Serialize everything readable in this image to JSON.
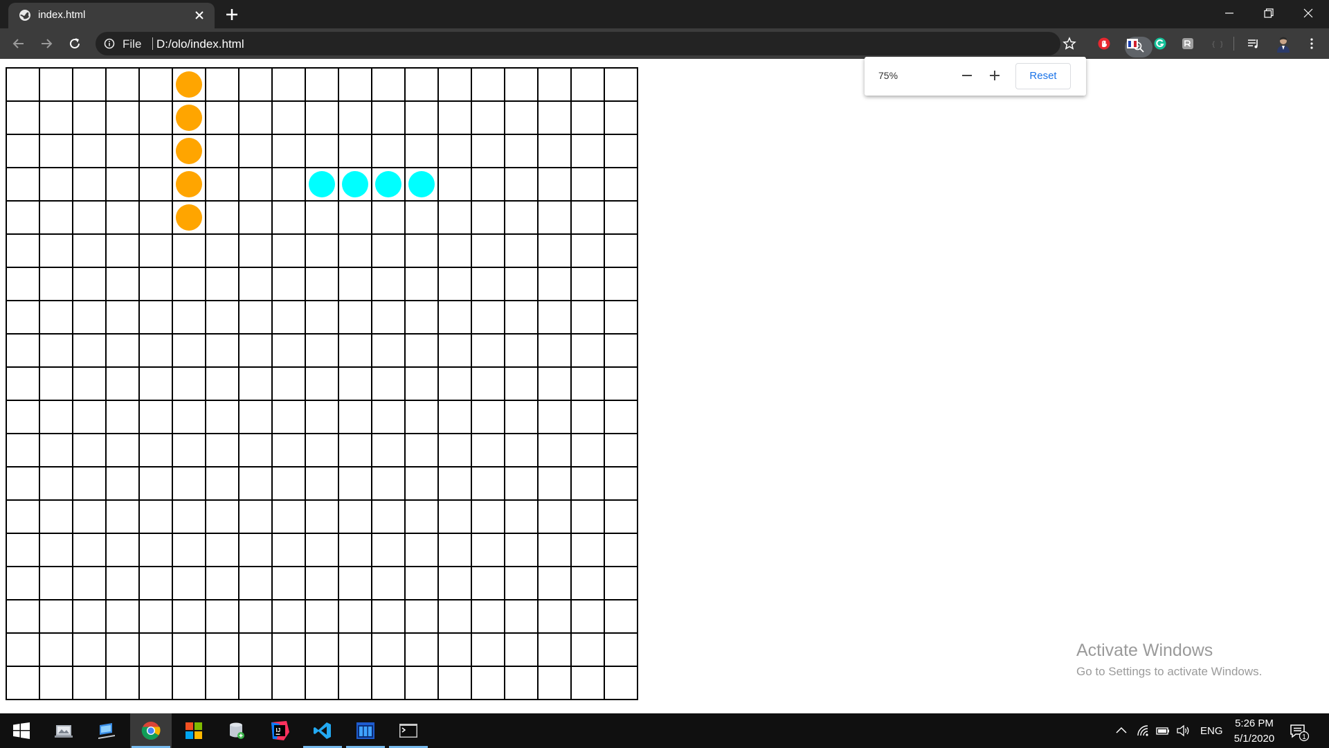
{
  "browser": {
    "tab": {
      "title": "index.html",
      "icon": "globe-icon"
    },
    "address": {
      "scheme_label": "File",
      "url": "D:/olo/index.html"
    },
    "extensions": [
      "adblock-icon",
      "flag-extension-icon",
      "grammarly-icon",
      "extension-icon",
      "extension-disabled-icon"
    ]
  },
  "zoom_popup": {
    "level": "75%",
    "reset_label": "Reset",
    "accent_color": "#1a73e8"
  },
  "board": {
    "rows": 19,
    "cols": 19,
    "line_color": "#000000",
    "stones": [
      {
        "row": 0,
        "col": 5,
        "color": "#ffa500"
      },
      {
        "row": 1,
        "col": 5,
        "color": "#ffa500"
      },
      {
        "row": 2,
        "col": 5,
        "color": "#ffa500"
      },
      {
        "row": 3,
        "col": 5,
        "color": "#ffa500"
      },
      {
        "row": 4,
        "col": 5,
        "color": "#ffa500"
      },
      {
        "row": 3,
        "col": 9,
        "color": "#00ffff"
      },
      {
        "row": 3,
        "col": 10,
        "color": "#00ffff"
      },
      {
        "row": 3,
        "col": 11,
        "color": "#00ffff"
      },
      {
        "row": 3,
        "col": 12,
        "color": "#00ffff"
      }
    ]
  },
  "watermark": {
    "line1": "Activate Windows",
    "line2": "Go to Settings to activate Windows."
  },
  "taskbar": {
    "apps": [
      "windows-start-icon",
      "photos-app-icon",
      "remote-desktop-icon",
      "chrome-icon",
      "office-icon",
      "database-icon",
      "intellij-icon",
      "vscode-icon",
      "editor-app-icon",
      "terminal-icon"
    ],
    "language": "ENG",
    "time": "5:26 PM",
    "date": "5/1/2020",
    "notification_count": "1"
  }
}
